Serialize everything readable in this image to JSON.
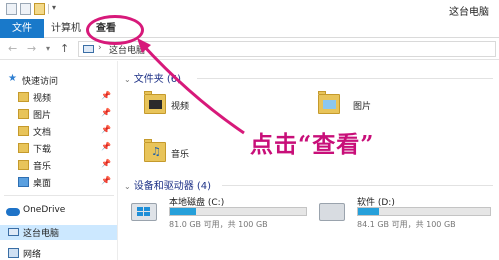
{
  "window": {
    "title": "这台电脑"
  },
  "ribbon": {
    "tabs": [
      {
        "label": "文件"
      },
      {
        "label": "计算机"
      },
      {
        "label": "查看"
      }
    ]
  },
  "address": {
    "path": "这台电脑"
  },
  "sidebar": {
    "quick_access": "快速访问",
    "pinned": [
      {
        "label": "视频",
        "icon": "video-folder-icon"
      },
      {
        "label": "图片",
        "icon": "pictures-folder-icon"
      },
      {
        "label": "文档",
        "icon": "documents-folder-icon"
      },
      {
        "label": "下载",
        "icon": "downloads-folder-icon"
      },
      {
        "label": "音乐",
        "icon": "music-folder-icon"
      },
      {
        "label": "桌面",
        "icon": "desktop-folder-icon"
      }
    ],
    "onedrive": "OneDrive",
    "this_pc": "这台电脑",
    "network": "网络"
  },
  "content": {
    "folders_header": "文件夹 (6)",
    "folders": [
      {
        "label": "视频",
        "icon": "video-folder-icon"
      },
      {
        "label": "图片",
        "icon": "pictures-folder-icon"
      },
      {
        "label": "音乐",
        "icon": "music-folder-icon"
      }
    ],
    "devices_header": "设备和驱动器 (4)",
    "drives": [
      {
        "name": "本地磁盘 (C:)",
        "free_text": "81.0 GB 可用，共 100 GB",
        "used_fraction": 0.19
      },
      {
        "name": "软件 (D:)",
        "free_text": "84.1 GB 可用，共 100 GB",
        "used_fraction": 0.16
      }
    ]
  },
  "annotation": {
    "text": "点击“查看”",
    "color": "#c80f79"
  }
}
